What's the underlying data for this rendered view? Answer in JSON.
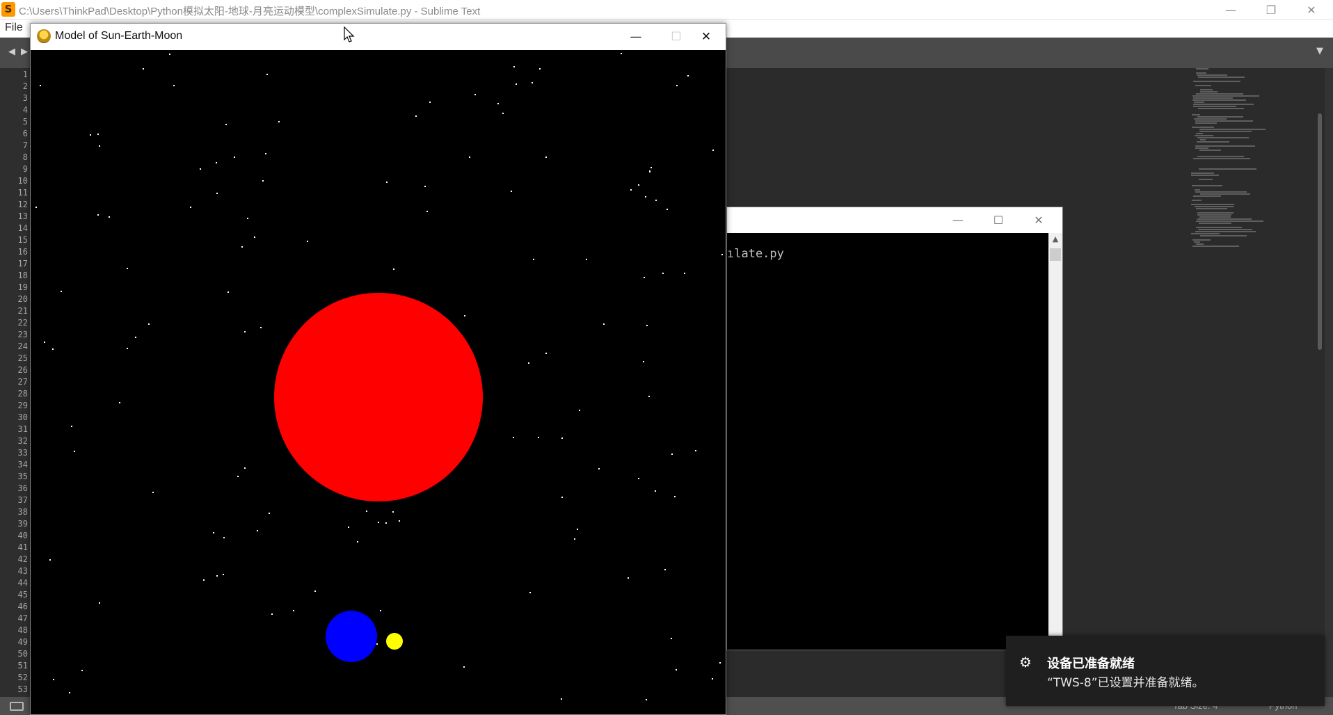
{
  "sublime": {
    "title": "C:\\Users\\ThinkPad\\Desktop\\Python模拟太阳-地球-月亮运动模型\\complexSimulate.py - Sublime Text",
    "logo_letter": "S",
    "menu_file": "File",
    "controls": {
      "minimize": "—",
      "restore": "❐",
      "close": "✕"
    },
    "tab_nav": {
      "left": "◀",
      "right": "▶",
      "dropdown": "▼"
    },
    "line_numbers": [
      "1",
      "2",
      "3",
      "4",
      "5",
      "6",
      "7",
      "8",
      "9",
      "10",
      "11",
      "12",
      "13",
      "14",
      "15",
      "16",
      "17",
      "18",
      "19",
      "20",
      "21",
      "22",
      "23",
      "24",
      "25",
      "26",
      "27",
      "28",
      "29",
      "30",
      "31",
      "32",
      "33",
      "34",
      "35",
      "36",
      "37",
      "38",
      "39",
      "40",
      "41",
      "42",
      "43",
      "44",
      "45",
      "46",
      "47",
      "48",
      "49",
      "50",
      "51",
      "52",
      "53"
    ],
    "status": {
      "tab_size": "Tab Size: 4",
      "syntax": "Python"
    },
    "colors": {
      "editor_bg": "#2b2b2b",
      "gutter_bg": "#2e2e2e",
      "tabbar_bg": "#4a4a4a",
      "statusbar_bg": "#4f4f4f"
    }
  },
  "console": {
    "text": "ılate.py",
    "controls": {
      "minimize": "—",
      "maximize": "☐",
      "close": "✕"
    },
    "scroll_up": "▲"
  },
  "pygame": {
    "title": "Model of Sun-Earth-Moon",
    "controls": {
      "minimize": "—",
      "maximize": "☐",
      "close": "✕"
    },
    "icon": "pygame-snake-icon",
    "colors": {
      "background": "#000000",
      "sun": "#ff0000",
      "earth": "#0000ff",
      "moon": "#ffff00",
      "star": "#ffffff"
    }
  },
  "toast": {
    "icon": "gear-icon",
    "icon_glyph": "⚙",
    "title": "设备已准备就绪",
    "body": "“TWS-8”已设置并准备就绪。"
  }
}
